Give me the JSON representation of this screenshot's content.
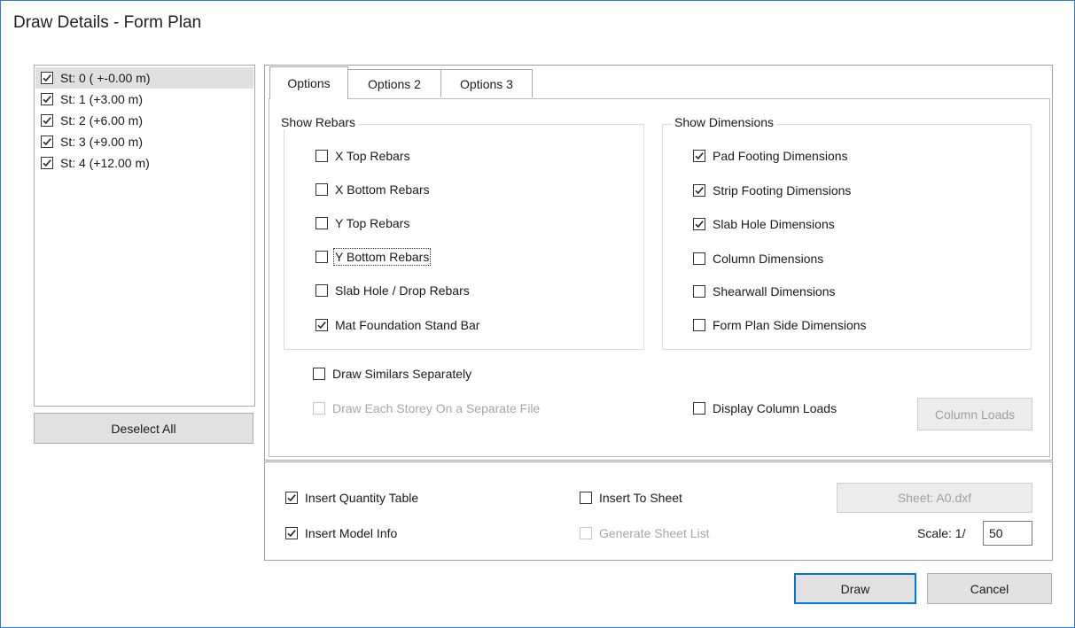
{
  "window": {
    "title": "Draw Details - Form Plan"
  },
  "storeys": [
    {
      "label": "St: 0 ( +-0.00 m)",
      "checked": true,
      "selected": true
    },
    {
      "label": "St: 1 (+3.00 m)",
      "checked": true,
      "selected": false
    },
    {
      "label": "St: 2 (+6.00 m)",
      "checked": true,
      "selected": false
    },
    {
      "label": "St: 3 (+9.00 m)",
      "checked": true,
      "selected": false
    },
    {
      "label": "St: 4 (+12.00 m)",
      "checked": true,
      "selected": false
    }
  ],
  "deselect_all_label": "Deselect All",
  "tabs": [
    {
      "label": "Options",
      "active": true
    },
    {
      "label": "Options 2",
      "active": false
    },
    {
      "label": "Options 3",
      "active": false
    }
  ],
  "show_rebars": {
    "title": "Show Rebars",
    "items": [
      {
        "label": "X Top Rebars",
        "checked": false
      },
      {
        "label": "X Bottom Rebars",
        "checked": false
      },
      {
        "label": "Y Top Rebars",
        "checked": false
      },
      {
        "label": "Y Bottom Rebars",
        "checked": false
      },
      {
        "label": "Slab Hole / Drop Rebars",
        "checked": false
      },
      {
        "label": "Mat Foundation Stand Bar",
        "checked": true
      }
    ]
  },
  "show_dimensions": {
    "title": "Show Dimensions",
    "items": [
      {
        "label": "Pad Footing Dimensions",
        "checked": true
      },
      {
        "label": "Strip Footing Dimensions",
        "checked": true
      },
      {
        "label": "Slab Hole Dimensions",
        "checked": true
      },
      {
        "label": "Column Dimensions",
        "checked": false
      },
      {
        "label": "Shearwall Dimensions",
        "checked": false
      },
      {
        "label": "Form Plan Side Dimensions",
        "checked": false
      }
    ]
  },
  "options": {
    "draw_similars_separately": {
      "label": "Draw Similars Separately",
      "checked": false
    },
    "draw_each_storey_separate": {
      "label": "Draw Each Storey On a Separate File",
      "checked": false,
      "enabled": false
    },
    "display_column_loads": {
      "label": "Display Column Loads",
      "checked": false
    },
    "column_loads_button": "Column Loads"
  },
  "bottom": {
    "insert_quantity_table": {
      "label": "Insert Quantity Table",
      "checked": true
    },
    "insert_model_info": {
      "label": "Insert Model Info",
      "checked": true
    },
    "insert_to_sheet": {
      "label": "Insert To Sheet",
      "checked": false
    },
    "generate_sheet_list": {
      "label": "Generate Sheet List",
      "checked": false,
      "enabled": false
    },
    "sheet_button": "Sheet: A0.dxf",
    "scale_label": "Scale: 1/",
    "scale_value": "50"
  },
  "actions": {
    "draw": "Draw",
    "cancel": "Cancel"
  },
  "colors": {
    "accent": "#0078d7",
    "window_border": "#2b7cd3",
    "selected_row": "#e0e0e0"
  }
}
